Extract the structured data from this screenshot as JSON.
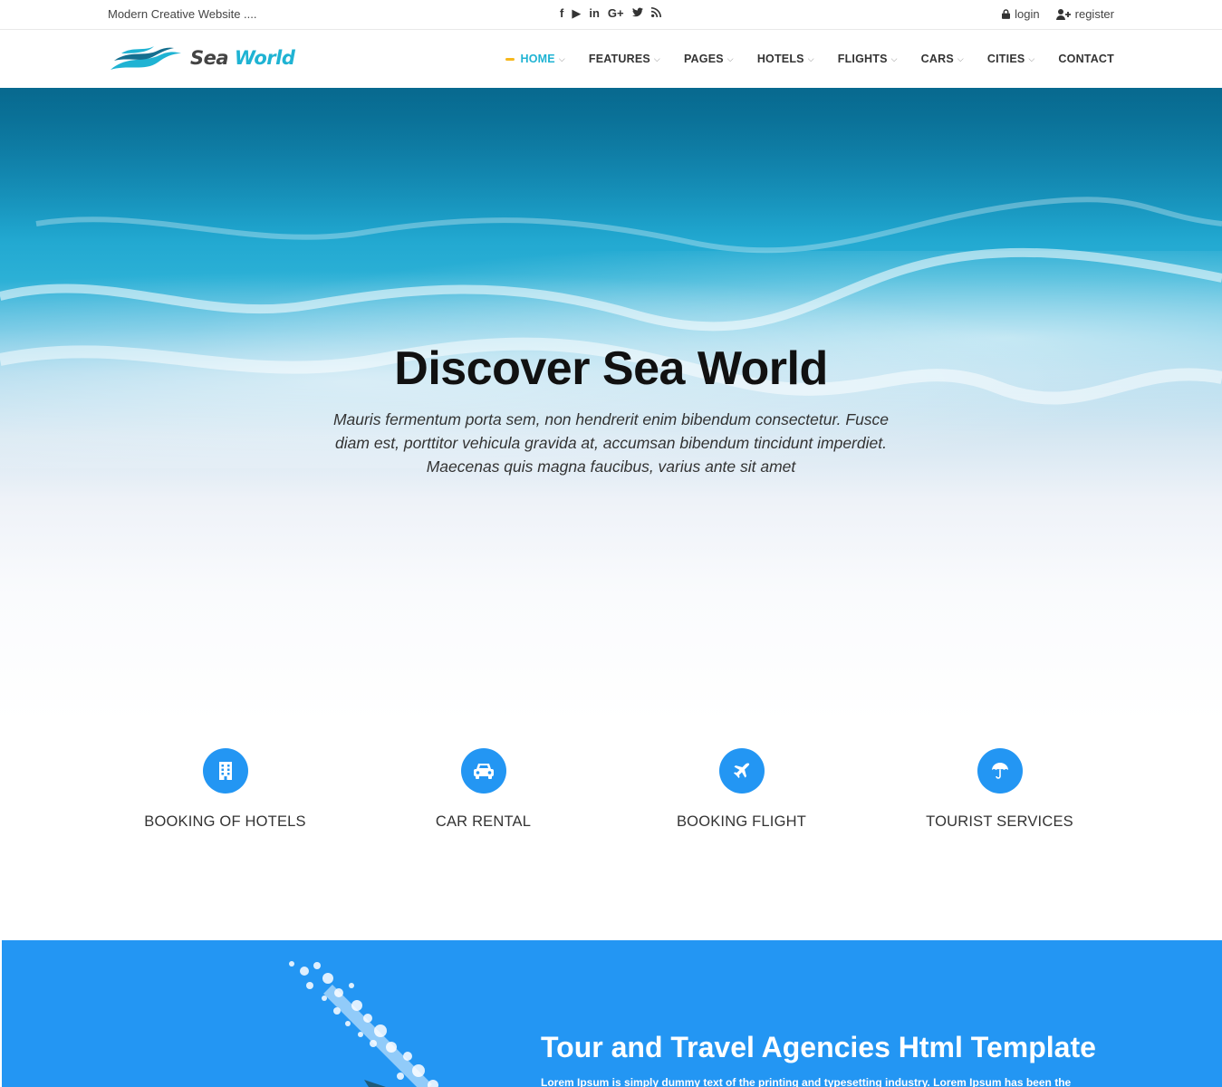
{
  "topbar": {
    "tagline": "Modern Creative Website ....",
    "socials": [
      {
        "icon": "facebook-icon",
        "glyph": "f"
      },
      {
        "icon": "youtube-icon",
        "glyph": "▶"
      },
      {
        "icon": "linkedin-icon",
        "glyph": "in"
      },
      {
        "icon": "google-plus-icon",
        "glyph": "G+"
      },
      {
        "icon": "twitter-icon",
        "glyph": "🐦"
      },
      {
        "icon": "rss-icon",
        "glyph": "◔"
      }
    ],
    "login_label": "login",
    "register_label": "register"
  },
  "header": {
    "logo_sea": "Sea",
    "logo_world": "World",
    "nav": [
      {
        "label": "HOME",
        "active": true,
        "dropdown": true
      },
      {
        "label": "FEATURES",
        "active": false,
        "dropdown": true
      },
      {
        "label": "PAGES",
        "active": false,
        "dropdown": true
      },
      {
        "label": "HOTELS",
        "active": false,
        "dropdown": true
      },
      {
        "label": "FLIGHTS",
        "active": false,
        "dropdown": true
      },
      {
        "label": "CARS",
        "active": false,
        "dropdown": true
      },
      {
        "label": "CITIES",
        "active": false,
        "dropdown": true
      },
      {
        "label": "CONTACT",
        "active": false,
        "dropdown": false
      }
    ]
  },
  "hero": {
    "title": "Discover Sea World",
    "lead": "Mauris fermentum porta sem, non hendrerit enim bibendum consectetur. Fusce diam est, porttitor vehicula gravida at, accumsan bibendum tincidunt imperdiet. Maecenas quis magna faucibus, varius ante sit amet"
  },
  "services": [
    {
      "label": "BOOKING OF HOTELS",
      "icon": "building-icon"
    },
    {
      "label": "CAR RENTAL",
      "icon": "car-icon"
    },
    {
      "label": "BOOKING FLIGHT",
      "icon": "plane-icon"
    },
    {
      "label": "TOURIST SERVICES",
      "icon": "umbrella-icon"
    }
  ],
  "promo": {
    "heading": "Tour and Travel Agencies Html Template",
    "text": "Lorem Ipsum is simply dummy text of the printing and typesetting industry. Lorem Ipsum has been the"
  },
  "colors": {
    "accent": "#1fb3d3",
    "primary_blue": "#2396f3",
    "nav_marker": "#f6b81d"
  }
}
